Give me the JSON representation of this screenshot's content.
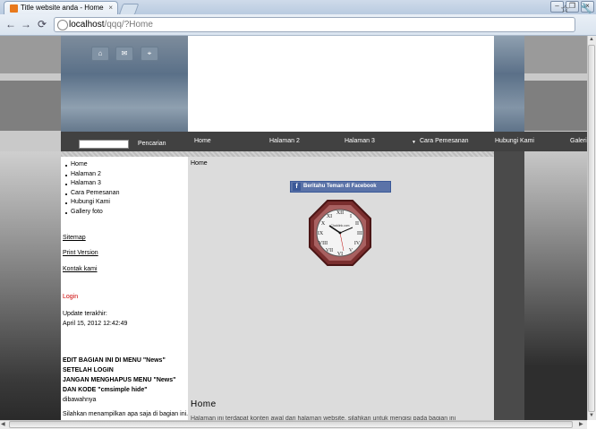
{
  "browser": {
    "tab_title": "Title website anda - Home",
    "tab_close": "×",
    "url_host": "localhost",
    "url_path": "/qqq/?Home",
    "back": "←",
    "forward": "→",
    "reload": "⟳",
    "star": "☆",
    "wrench": "🔧",
    "win_min": "–",
    "win_max": "❐",
    "win_close": "×"
  },
  "header": {
    "icons": [
      "home-icon",
      "mail-icon",
      "sitemap-icon"
    ],
    "icon_glyphs": [
      "⌂",
      "✉",
      "⌖"
    ]
  },
  "menu": {
    "search_label": "Pencarian",
    "items": [
      "Home",
      "Halaman 2",
      "Halaman 3",
      "Cara Pemesanan",
      "Hubungi Kami",
      "Galeri"
    ]
  },
  "sidebar": {
    "nav": [
      "Home",
      "Halaman 2",
      "Halaman 3",
      "Cara Pemesanan",
      "Hubungi Kami",
      "Gallery foto"
    ],
    "sitemap": "Sitemap",
    "print": "Print Version",
    "contact": "Kontak kami",
    "login": "Login",
    "update_label": "Update terakhir:",
    "update_date": "April 15, 2012 12:42:49",
    "note_lines": [
      "EDIT BAGIAN INI DI MENU \"News\"",
      "SETELAH LOGIN",
      "JANGAN MENGHAPUS MENU \"News\"",
      "DAN KODE \"cmsimple hide\"",
      "dibawahnya"
    ],
    "note_bottom": "Silahkan menampilkan apa saja di bagian ini."
  },
  "content": {
    "breadcrumb": "Home",
    "fb_button": "Beritahu Teman di Facebook",
    "clock_brand": "Clocklink.com",
    "heading": "Home",
    "teaser": "Halaman ini terdapat konten awal dari halaman website, silahkan untuk mengisi pada bagian ini"
  },
  "colors": {
    "menu_bg": "#414141",
    "fb_blue": "#3b5998",
    "login_red": "#cc0000",
    "header_blue": "#5a7088"
  }
}
